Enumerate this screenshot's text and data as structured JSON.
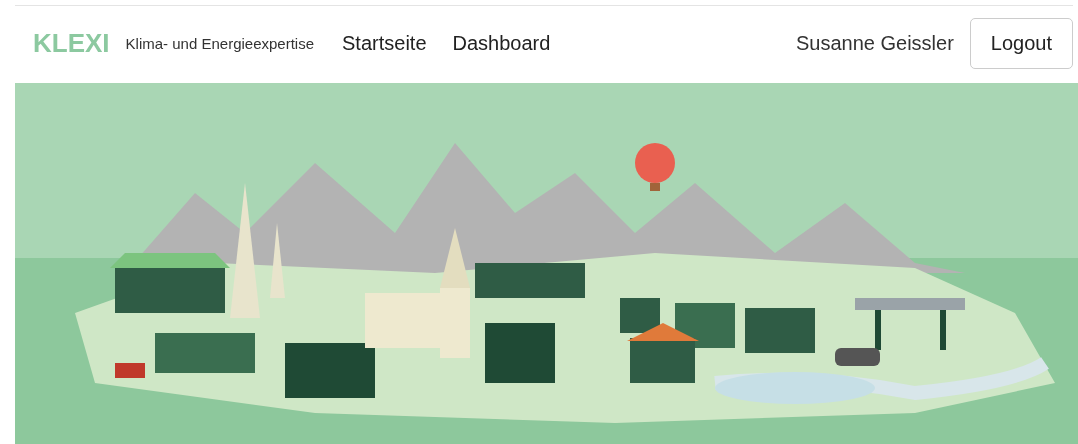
{
  "navbar": {
    "brand": "KLEXI",
    "tagline": "Klima- und Energieexpertise",
    "links": [
      {
        "label": "Startseite"
      },
      {
        "label": "Dashboard"
      }
    ],
    "user": "Susanne Geissler",
    "logout": "Logout"
  }
}
